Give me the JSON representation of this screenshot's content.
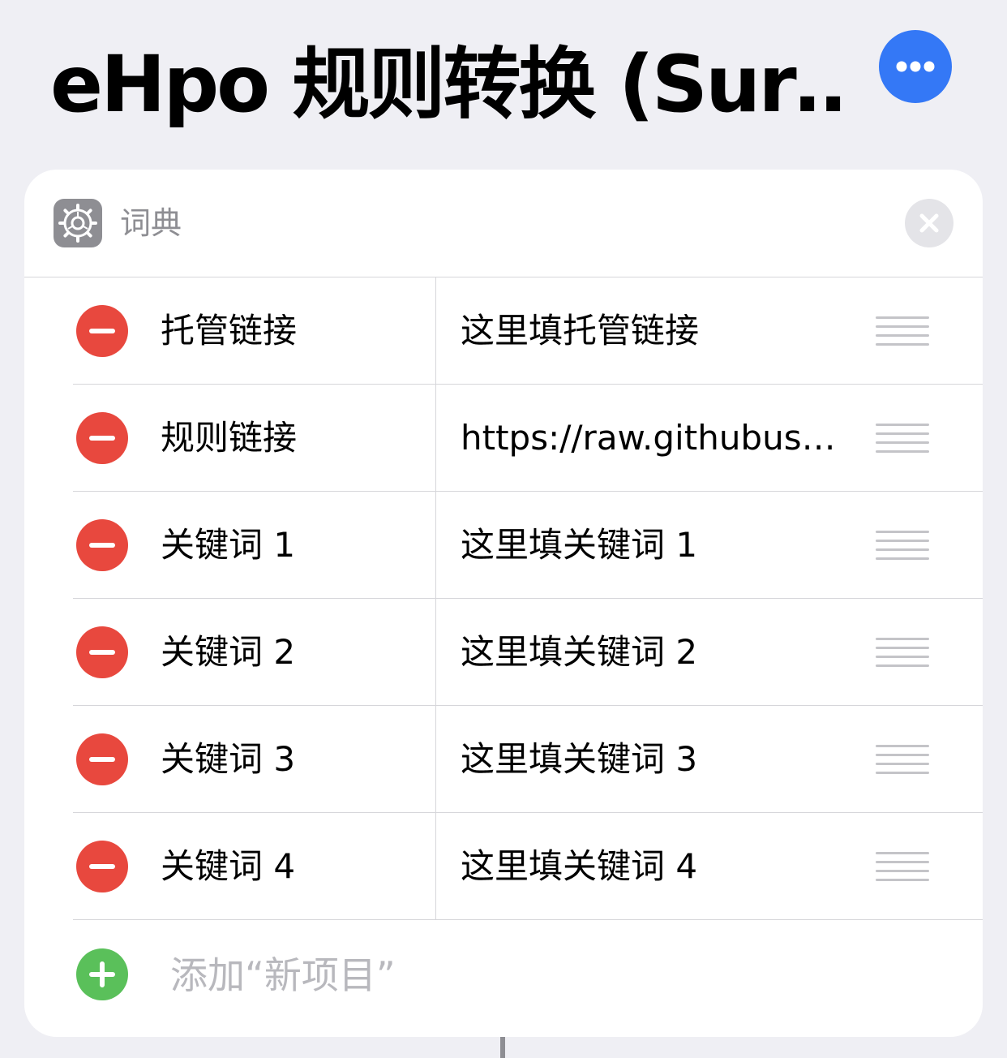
{
  "header": {
    "title": "eHpo 规则转换 (Sur…",
    "more_icon": "ellipsis-icon",
    "accent_color": "#3478f6"
  },
  "card": {
    "icon": "gear-icon",
    "title": "词典",
    "close_icon": "close-icon",
    "rows": [
      {
        "key": "托管链接",
        "value": "这里填托管链接"
      },
      {
        "key": "规则链接",
        "value": "https://raw.githubuse…"
      },
      {
        "key": "关键词 1",
        "value": "这里填关键词 1"
      },
      {
        "key": "关键词 2",
        "value": "这里填关键词 2"
      },
      {
        "key": "关键词 3",
        "value": "这里填关键词 3"
      },
      {
        "key": "关键词 4",
        "value": "这里填关键词 4"
      }
    ],
    "add_label": "添加“新项目”",
    "remove_color": "#e8483e",
    "add_color": "#5ac05a"
  }
}
